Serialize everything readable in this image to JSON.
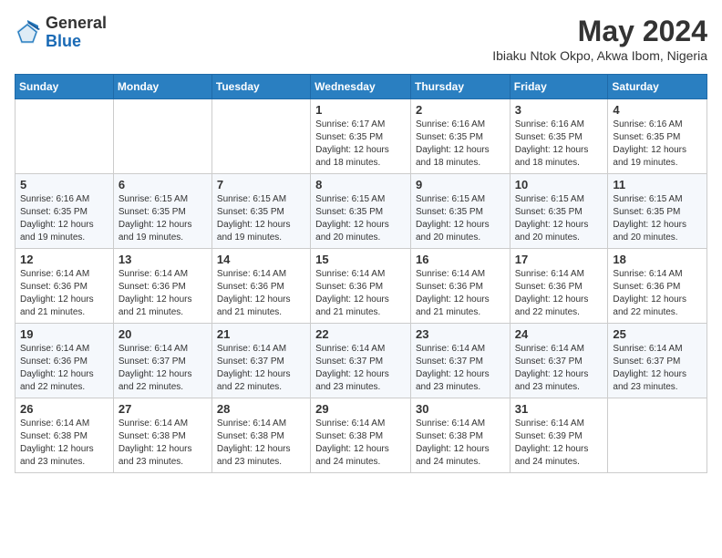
{
  "header": {
    "logo_general": "General",
    "logo_blue": "Blue",
    "month_title": "May 2024",
    "location": "Ibiaku Ntok Okpo, Akwa Ibom, Nigeria"
  },
  "weekdays": [
    "Sunday",
    "Monday",
    "Tuesday",
    "Wednesday",
    "Thursday",
    "Friday",
    "Saturday"
  ],
  "weeks": [
    [
      {
        "day": "",
        "info": ""
      },
      {
        "day": "",
        "info": ""
      },
      {
        "day": "",
        "info": ""
      },
      {
        "day": "1",
        "info": "Sunrise: 6:17 AM\nSunset: 6:35 PM\nDaylight: 12 hours and 18 minutes."
      },
      {
        "day": "2",
        "info": "Sunrise: 6:16 AM\nSunset: 6:35 PM\nDaylight: 12 hours and 18 minutes."
      },
      {
        "day": "3",
        "info": "Sunrise: 6:16 AM\nSunset: 6:35 PM\nDaylight: 12 hours and 18 minutes."
      },
      {
        "day": "4",
        "info": "Sunrise: 6:16 AM\nSunset: 6:35 PM\nDaylight: 12 hours and 19 minutes."
      }
    ],
    [
      {
        "day": "5",
        "info": "Sunrise: 6:16 AM\nSunset: 6:35 PM\nDaylight: 12 hours and 19 minutes."
      },
      {
        "day": "6",
        "info": "Sunrise: 6:15 AM\nSunset: 6:35 PM\nDaylight: 12 hours and 19 minutes."
      },
      {
        "day": "7",
        "info": "Sunrise: 6:15 AM\nSunset: 6:35 PM\nDaylight: 12 hours and 19 minutes."
      },
      {
        "day": "8",
        "info": "Sunrise: 6:15 AM\nSunset: 6:35 PM\nDaylight: 12 hours and 20 minutes."
      },
      {
        "day": "9",
        "info": "Sunrise: 6:15 AM\nSunset: 6:35 PM\nDaylight: 12 hours and 20 minutes."
      },
      {
        "day": "10",
        "info": "Sunrise: 6:15 AM\nSunset: 6:35 PM\nDaylight: 12 hours and 20 minutes."
      },
      {
        "day": "11",
        "info": "Sunrise: 6:15 AM\nSunset: 6:35 PM\nDaylight: 12 hours and 20 minutes."
      }
    ],
    [
      {
        "day": "12",
        "info": "Sunrise: 6:14 AM\nSunset: 6:36 PM\nDaylight: 12 hours and 21 minutes."
      },
      {
        "day": "13",
        "info": "Sunrise: 6:14 AM\nSunset: 6:36 PM\nDaylight: 12 hours and 21 minutes."
      },
      {
        "day": "14",
        "info": "Sunrise: 6:14 AM\nSunset: 6:36 PM\nDaylight: 12 hours and 21 minutes."
      },
      {
        "day": "15",
        "info": "Sunrise: 6:14 AM\nSunset: 6:36 PM\nDaylight: 12 hours and 21 minutes."
      },
      {
        "day": "16",
        "info": "Sunrise: 6:14 AM\nSunset: 6:36 PM\nDaylight: 12 hours and 21 minutes."
      },
      {
        "day": "17",
        "info": "Sunrise: 6:14 AM\nSunset: 6:36 PM\nDaylight: 12 hours and 22 minutes."
      },
      {
        "day": "18",
        "info": "Sunrise: 6:14 AM\nSunset: 6:36 PM\nDaylight: 12 hours and 22 minutes."
      }
    ],
    [
      {
        "day": "19",
        "info": "Sunrise: 6:14 AM\nSunset: 6:36 PM\nDaylight: 12 hours and 22 minutes."
      },
      {
        "day": "20",
        "info": "Sunrise: 6:14 AM\nSunset: 6:37 PM\nDaylight: 12 hours and 22 minutes."
      },
      {
        "day": "21",
        "info": "Sunrise: 6:14 AM\nSunset: 6:37 PM\nDaylight: 12 hours and 22 minutes."
      },
      {
        "day": "22",
        "info": "Sunrise: 6:14 AM\nSunset: 6:37 PM\nDaylight: 12 hours and 23 minutes."
      },
      {
        "day": "23",
        "info": "Sunrise: 6:14 AM\nSunset: 6:37 PM\nDaylight: 12 hours and 23 minutes."
      },
      {
        "day": "24",
        "info": "Sunrise: 6:14 AM\nSunset: 6:37 PM\nDaylight: 12 hours and 23 minutes."
      },
      {
        "day": "25",
        "info": "Sunrise: 6:14 AM\nSunset: 6:37 PM\nDaylight: 12 hours and 23 minutes."
      }
    ],
    [
      {
        "day": "26",
        "info": "Sunrise: 6:14 AM\nSunset: 6:38 PM\nDaylight: 12 hours and 23 minutes."
      },
      {
        "day": "27",
        "info": "Sunrise: 6:14 AM\nSunset: 6:38 PM\nDaylight: 12 hours and 23 minutes."
      },
      {
        "day": "28",
        "info": "Sunrise: 6:14 AM\nSunset: 6:38 PM\nDaylight: 12 hours and 23 minutes."
      },
      {
        "day": "29",
        "info": "Sunrise: 6:14 AM\nSunset: 6:38 PM\nDaylight: 12 hours and 24 minutes."
      },
      {
        "day": "30",
        "info": "Sunrise: 6:14 AM\nSunset: 6:38 PM\nDaylight: 12 hours and 24 minutes."
      },
      {
        "day": "31",
        "info": "Sunrise: 6:14 AM\nSunset: 6:39 PM\nDaylight: 12 hours and 24 minutes."
      },
      {
        "day": "",
        "info": ""
      }
    ]
  ]
}
